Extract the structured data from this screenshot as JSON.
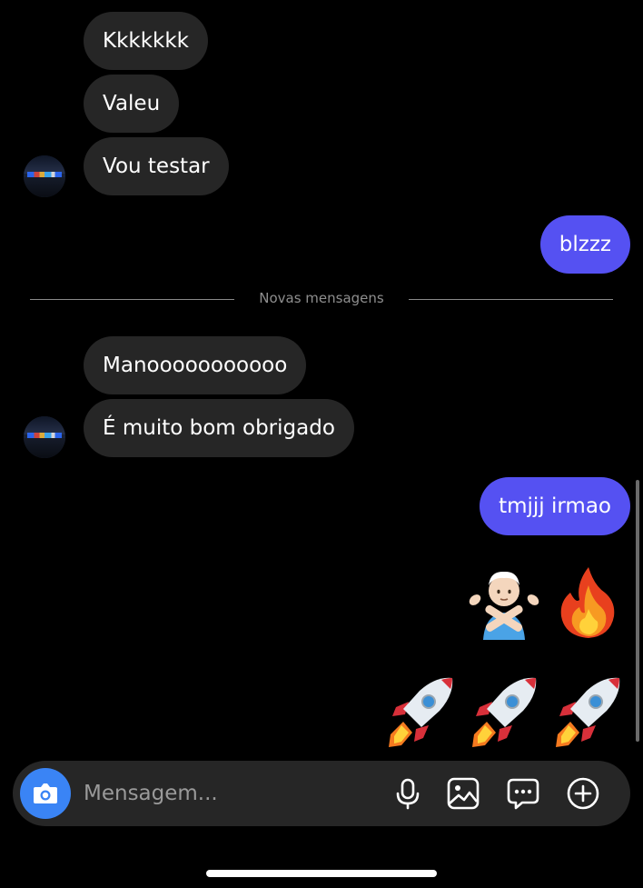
{
  "thread": {
    "received_group_1": [
      {
        "text": "Kkkkkkk"
      },
      {
        "text": "Valeu"
      },
      {
        "text": "Vou testar"
      }
    ],
    "sent_1": {
      "text": "blzzz"
    },
    "divider": {
      "label": "Novas mensagens"
    },
    "received_group_2": [
      {
        "text": "Manooooooooooo"
      },
      {
        "text": "É muito bom obrigado"
      }
    ],
    "sent_2": {
      "text": "tmjjj irmao"
    },
    "emoji_row_1": [
      "person-gesturing-no-emoji",
      "fire-emoji"
    ],
    "emoji_row_2": [
      "rocket-emoji",
      "rocket-emoji",
      "rocket-emoji"
    ]
  },
  "composer": {
    "placeholder": "Mensagem...",
    "value": "",
    "icons": [
      "camera-icon",
      "microphone-icon",
      "gallery-icon",
      "sticker-icon",
      "add-icon"
    ]
  },
  "colors": {
    "background": "#000000",
    "received_bubble": "#262626",
    "sent_bubble": "#5551f2",
    "camera_button": "#3a84f5",
    "divider_text": "#8e8e8e"
  }
}
